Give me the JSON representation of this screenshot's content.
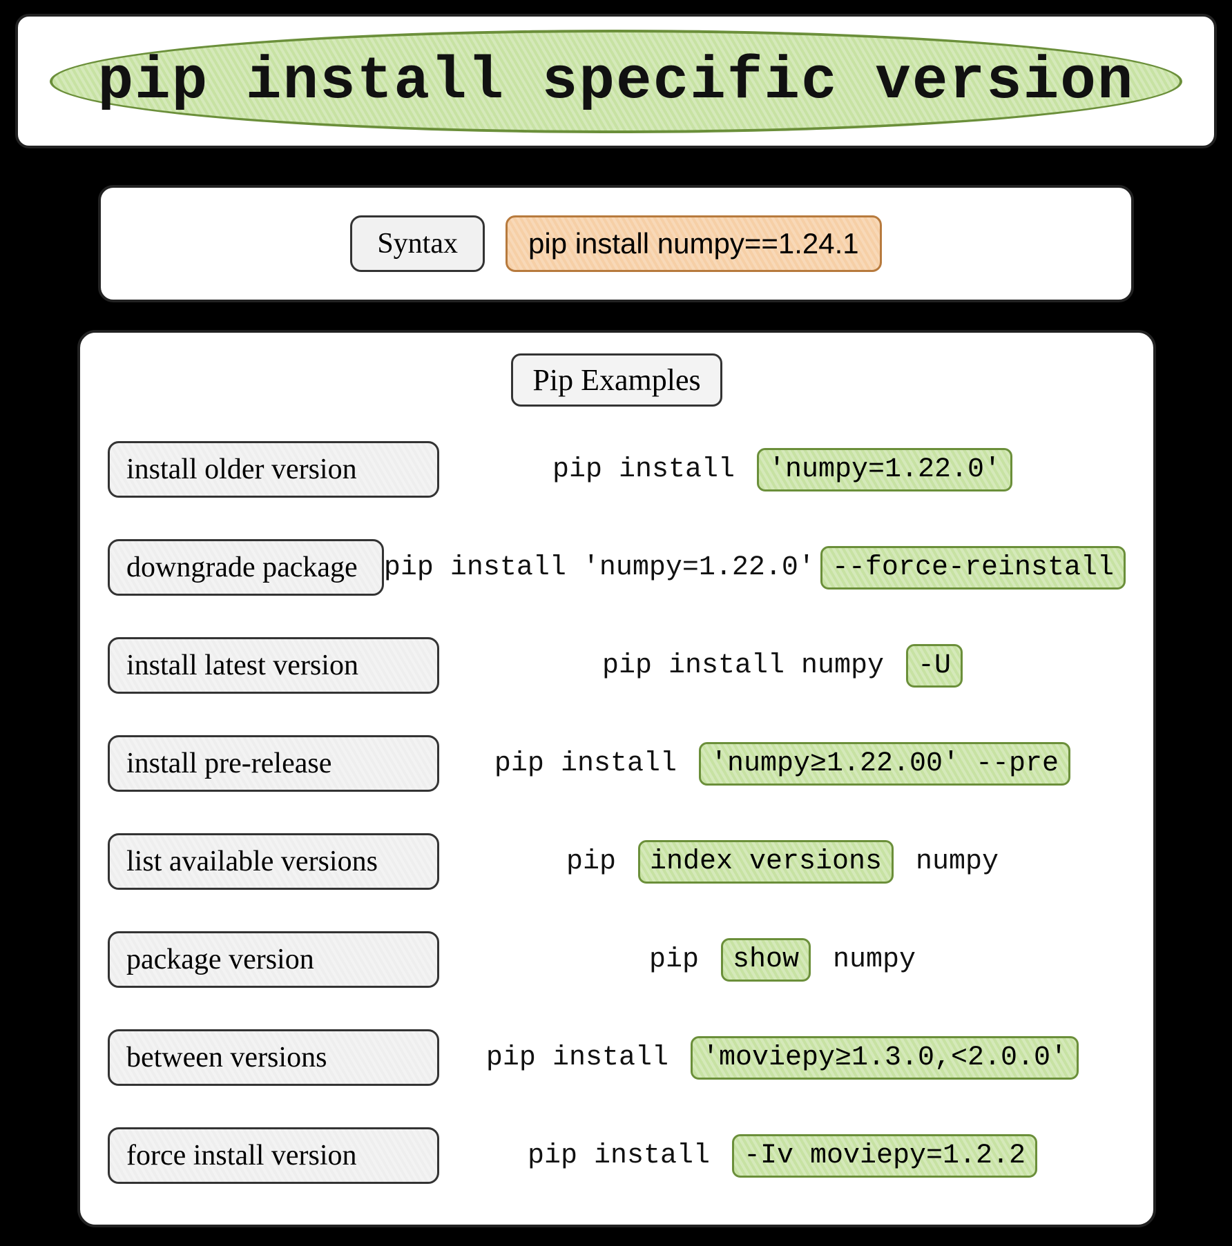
{
  "title": "pip install specific version",
  "syntax": {
    "label": "Syntax",
    "code": "pip install numpy==1.24.1"
  },
  "section_title": "Pip Examples",
  "examples": [
    {
      "label": "install older version",
      "parts": [
        {
          "t": "pip install ",
          "hl": false
        },
        {
          "t": "'numpy=1.22.0'",
          "hl": true
        }
      ]
    },
    {
      "label": "downgrade package",
      "parts": [
        {
          "t": "pip install 'numpy=1.22.0'",
          "hl": false
        },
        {
          "t": "--force-reinstall",
          "hl": true
        }
      ]
    },
    {
      "label": "install latest version",
      "parts": [
        {
          "t": "pip install numpy ",
          "hl": false
        },
        {
          "t": "-U",
          "hl": true
        }
      ]
    },
    {
      "label": "install pre-release",
      "parts": [
        {
          "t": "pip install ",
          "hl": false
        },
        {
          "t": "'numpy≥1.22.00' --pre",
          "hl": true
        }
      ]
    },
    {
      "label": "list available versions",
      "parts": [
        {
          "t": "pip ",
          "hl": false
        },
        {
          "t": "index versions",
          "hl": true
        },
        {
          "t": " numpy",
          "hl": false
        }
      ]
    },
    {
      "label": "package version",
      "parts": [
        {
          "t": "pip ",
          "hl": false
        },
        {
          "t": "show",
          "hl": true
        },
        {
          "t": " numpy",
          "hl": false
        }
      ]
    },
    {
      "label": "between versions",
      "parts": [
        {
          "t": "pip install ",
          "hl": false
        },
        {
          "t": "'moviepy≥1.3.0,<2.0.0'",
          "hl": true
        }
      ]
    },
    {
      "label": "force install version",
      "parts": [
        {
          "t": "pip install ",
          "hl": false
        },
        {
          "t": "-Iv moviepy=1.2.2",
          "hl": true
        }
      ]
    }
  ]
}
